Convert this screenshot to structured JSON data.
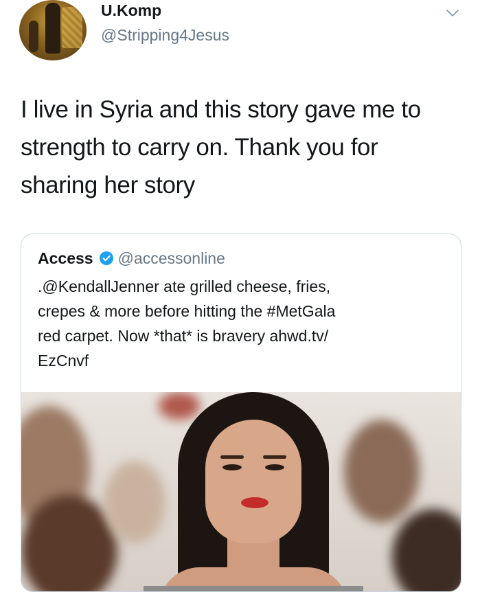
{
  "author": {
    "display_name": "U.Komp",
    "handle": "@Stripping4Jesus"
  },
  "tweet": {
    "text_lines": [
      "I live in Syria and this story gave me to",
      "strength to carry on. Thank you for",
      "sharing her story"
    ]
  },
  "quoted_tweet": {
    "name": "Access",
    "handle": "@accessonline",
    "verified": true,
    "text_lines": [
      ".@KendallJenner ate grilled cheese, fries,",
      "crepes & more before hitting the #MetGala",
      "red carpet. Now *that* is bravery ahwd.tv/",
      "EzCnvf"
    ]
  },
  "colors": {
    "text": "#14171a",
    "muted": "#657786",
    "verified": "#1da1f2",
    "border": "#ccd6dd"
  },
  "icons": {
    "menu": "chevron-down-icon",
    "verified": "verified-badge-icon"
  }
}
